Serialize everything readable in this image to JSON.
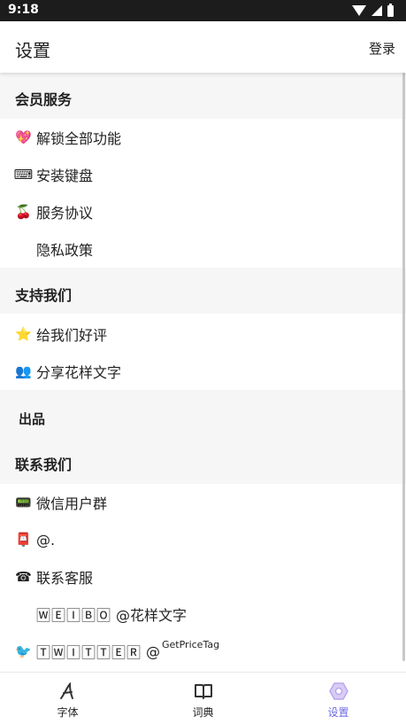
{
  "status_bar": {
    "time": "9:18"
  },
  "app_bar": {
    "title": "设置",
    "login_label": "登录"
  },
  "sections": {
    "member": {
      "header": "会员服务",
      "items": [
        {
          "icon": "💖",
          "label": "解锁全部功能"
        },
        {
          "icon": "⌨",
          "label": "安装键盘"
        },
        {
          "icon": "🍒",
          "label": "服务协议"
        },
        {
          "icon": "",
          "label": "隐私政策"
        }
      ]
    },
    "support": {
      "header": "支持我们",
      "items": [
        {
          "icon": "⭐",
          "label": "给我们好评"
        },
        {
          "icon": "👥",
          "label": "分享花样文字"
        }
      ]
    },
    "credit": {
      "prefix": "",
      "suffix": "出品"
    },
    "contact": {
      "header": "联系我们",
      "items": [
        {
          "icon": "📟",
          "label": "微信用户群"
        },
        {
          "icon": "📮",
          "label": "@."
        },
        {
          "icon": "☎",
          "label": "联系客服"
        },
        {
          "icon": "",
          "label_boxed": "🅆🄴🄸🄱🄾",
          "label_rest": "@花样文字"
        },
        {
          "icon": "🐦",
          "label_boxed": "🅃🅆🄸🅃🅃🄴🅁",
          "label_rest": "@",
          "label_sup": "GetPriceTag"
        }
      ]
    }
  },
  "bottom_nav": {
    "tabs": [
      {
        "label": "字体",
        "icon": "font-icon",
        "active": false
      },
      {
        "label": "词典",
        "icon": "book-icon",
        "active": false
      },
      {
        "label": "设置",
        "icon": "settings-icon",
        "active": true
      }
    ]
  },
  "colors": {
    "accent": "#6e6ae6",
    "section_bg": "#f6f6f6",
    "status_bar": "#1c1c1c"
  }
}
